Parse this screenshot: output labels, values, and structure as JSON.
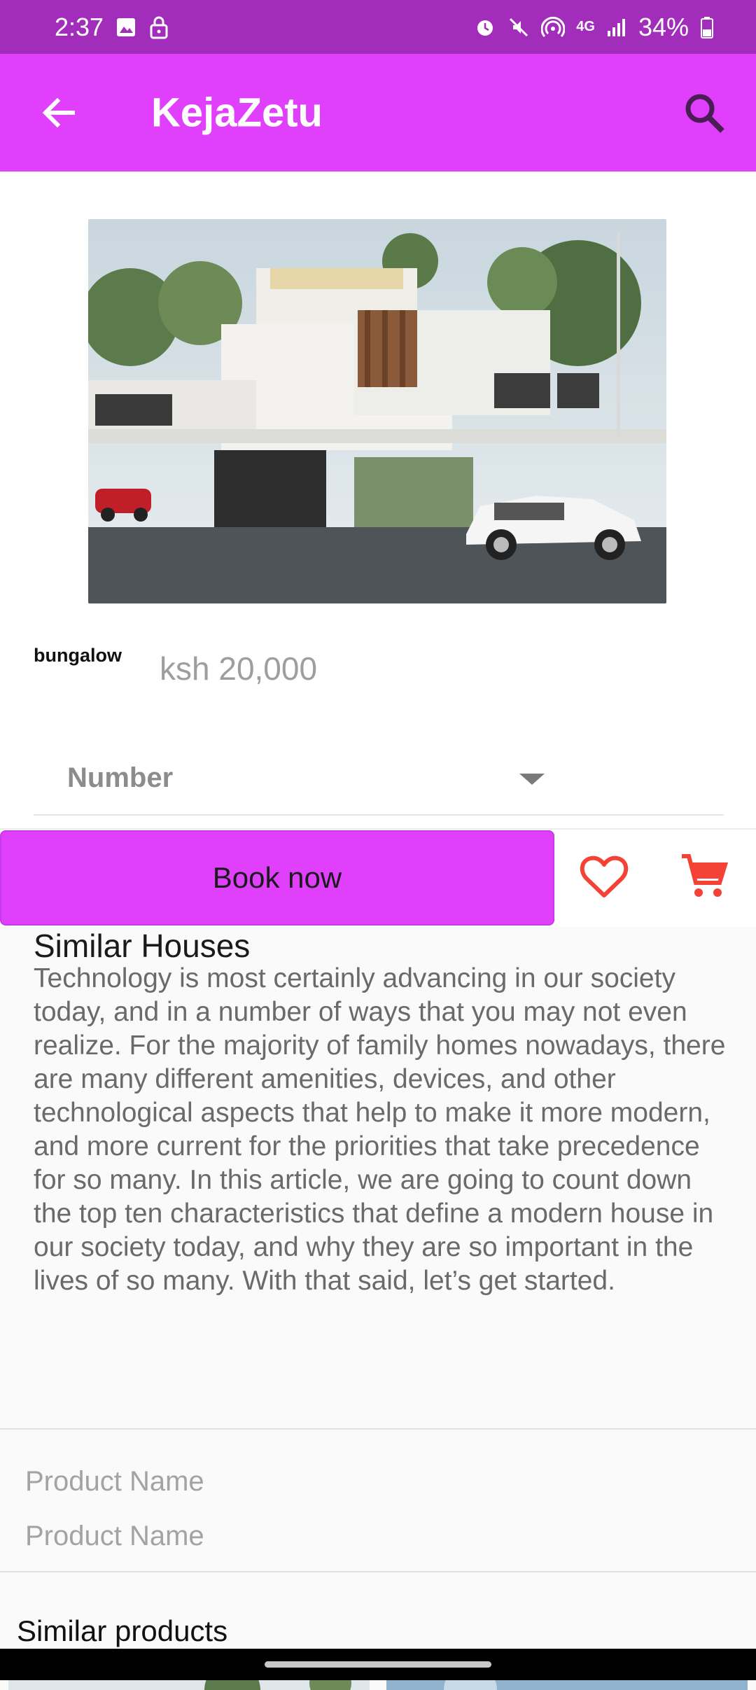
{
  "status_bar": {
    "time": "2:37",
    "battery": "34%",
    "network": "4G",
    "icons": [
      "image-icon",
      "lock-icon",
      "alarm-icon",
      "mute-icon",
      "hotspot-icon",
      "network-4g-icon",
      "signal-icon",
      "battery-icon"
    ]
  },
  "app_bar": {
    "title": "KejaZetu",
    "back_icon": "arrow-back-icon",
    "search_icon": "search-icon",
    "color": "#e040fb"
  },
  "listing": {
    "image_alt": "Modern white house with car",
    "name": "bungalow",
    "price": "ksh 20,000"
  },
  "dropdown": {
    "label": "Number",
    "icon": "dropdown-caret-icon"
  },
  "actions": {
    "book_label": "Book now",
    "favorite_icon": "heart-icon",
    "cart_icon": "cart-icon",
    "accent": "#f44336"
  },
  "similar": {
    "title": "Similar Houses",
    "description": "Technology is most certainly advancing in our society today, and in a number of ways that you may not even realize. For the majority of family homes nowadays, there are many different amenities, devices, and other technological aspects that help to make it more modern, and more current for the priorities that take precedence for so many. In this article, we are going to count down the top ten characteristics that define a modern house in our society today, and why they are so important in the lives of so many. With that said, let’s get started."
  },
  "product_names": [
    "Product Name",
    "Product Name"
  ],
  "similar_products": {
    "title": "Similar products"
  }
}
